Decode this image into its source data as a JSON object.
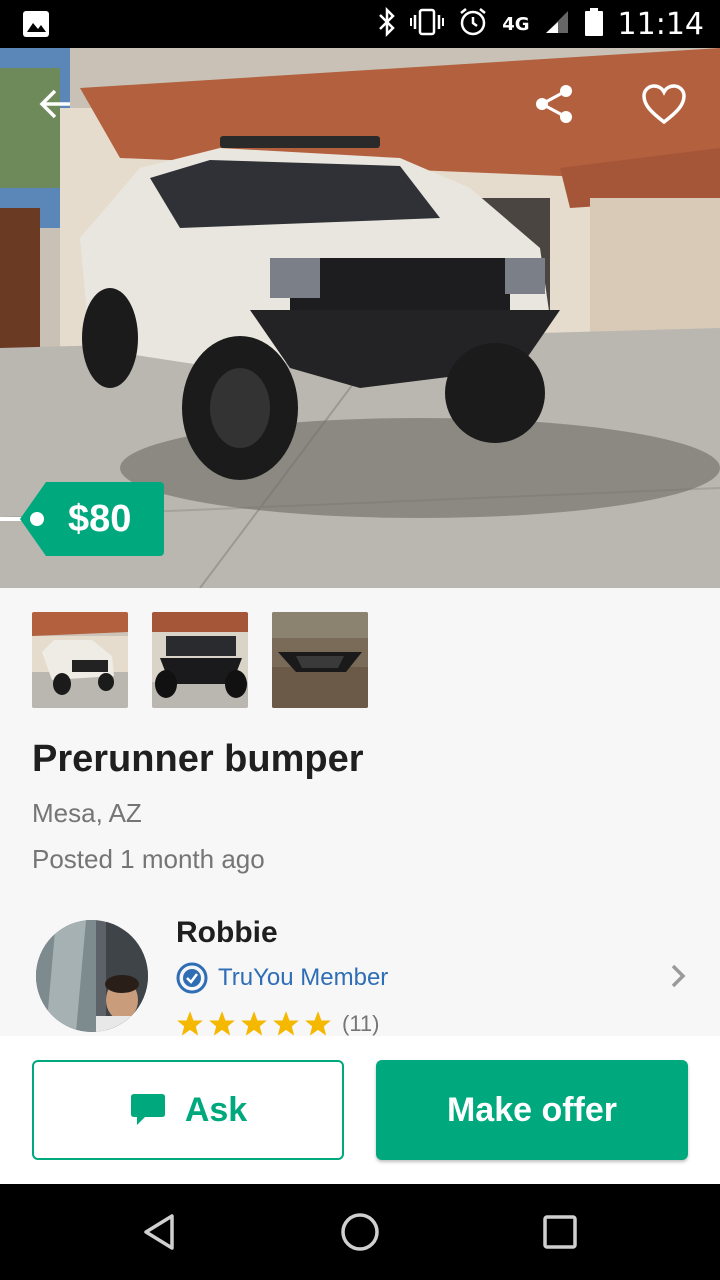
{
  "status_bar": {
    "time": "11:14",
    "network": "4G",
    "icons": [
      "image-icon",
      "bluetooth-icon",
      "vibrate-icon",
      "alarm-icon",
      "network-4g-icon",
      "signal-icon",
      "battery-icon"
    ]
  },
  "listing": {
    "price": "$80",
    "title": "Prerunner bumper",
    "location": "Mesa, AZ",
    "posted": "Posted 1 month ago",
    "thumbnails": [
      "truck-front-photo",
      "bumper-closeup-photo",
      "bumper-on-ground-photo"
    ]
  },
  "seller": {
    "name": "Robbie",
    "badge": "TruYou Member",
    "rating_stars": 5,
    "rating_count": "(11)"
  },
  "actions": {
    "ask_label": "Ask",
    "offer_label": "Make offer"
  },
  "colors": {
    "brand_green": "#00a87e",
    "badge_blue": "#2f6eb5",
    "star_yellow": "#f5b800"
  }
}
